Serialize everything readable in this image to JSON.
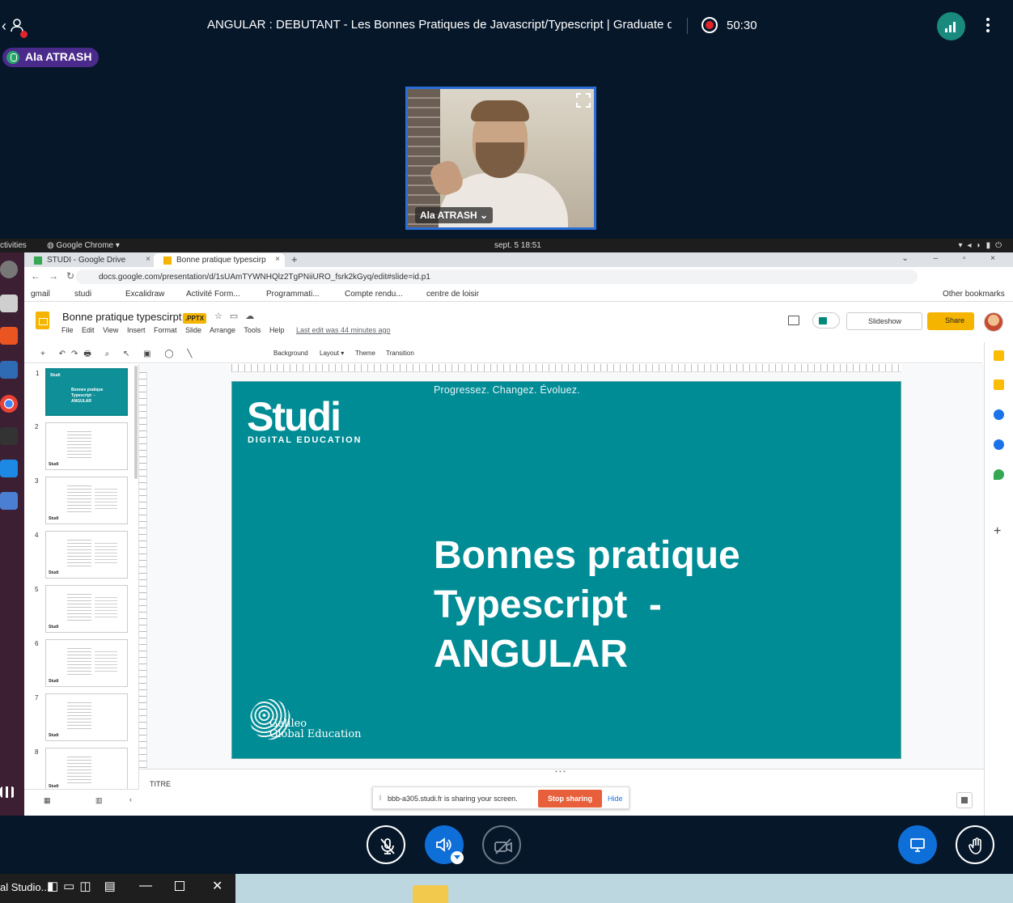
{
  "meeting": {
    "title": "ANGULAR : DEBUTANT - Les Bonnes Pratiques de Javascript/Typescript | Graduate devel…",
    "timer": "50:30",
    "speaker": "Ala ATRASH",
    "webcam_name": "Ala ATRASH ⌄"
  },
  "gnome": {
    "activities": "ctivities",
    "app": "◍ Google Chrome ▾",
    "clock": "sept. 5  18:51"
  },
  "chrome": {
    "tabs": [
      {
        "label": "STUDI - Google Drive",
        "close": "×"
      },
      {
        "label": "Bonne pratique typescirp",
        "close": "×"
      }
    ],
    "new_tab": "+",
    "url": "docs.google.com/presentation/d/1sUAmTYWNHQlz2TgPNiiURO_fsrk2kGyq/edit#slide=id.p1",
    "bookmarks": [
      "gmail",
      "studi",
      "Excalidraw",
      "Activité Form...",
      "Programmati...",
      "Compte rendu...",
      "centre de loisir"
    ],
    "other_bookmarks": "Other bookmarks"
  },
  "slides": {
    "doc_title": "Bonne pratique typescirpt",
    "badge": ".PPTX",
    "menu": [
      "File",
      "Edit",
      "View",
      "Insert",
      "Format",
      "Slide",
      "Arrange",
      "Tools",
      "Help"
    ],
    "last_edit": "Last edit was 44 minutes ago",
    "slideshow": "Slideshow",
    "share": "Share",
    "toolbar": {
      "background": "Background",
      "layout": "Layout ▾",
      "theme": "Theme",
      "transition": "Transition"
    },
    "thumb_numbers": [
      "1",
      "2",
      "3",
      "4",
      "5",
      "6",
      "7",
      "8"
    ],
    "thumb1_brand": "Studi",
    "thumb1_text": "Bonnes pratique\nTypescript  -\nANGULAR",
    "thumb_brand": "Studi",
    "notes_label": "TITRE"
  },
  "slide": {
    "tagline": "Progressez. Changez. Évoluez.",
    "logo": "Studi",
    "logo_sub": "DIGITAL EDUCATION",
    "title": "Bonnes pratique\nTypescript  -\nANGULAR",
    "partner": "Galileo\nGlobal Education",
    "background_color": "#008c95"
  },
  "share_banner": {
    "message": "bbb-a305.studi.fr is sharing your screen.",
    "stop": "Stop sharing",
    "hide": "Hide"
  },
  "taskbar": {
    "window_label": "al Studio..."
  },
  "colors": {
    "accent_blue": "#0f6fd8",
    "record_red": "#e0252b",
    "slides_yellow": "#f4b400"
  }
}
